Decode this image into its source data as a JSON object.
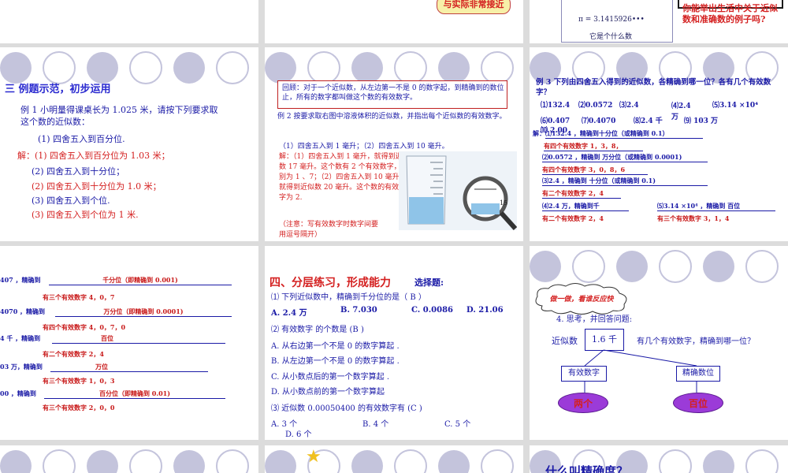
{
  "s_top2": {
    "bubble": "与实际非常接近"
  },
  "s_top3": {
    "pi": "π = 3.1415926•••",
    "pi_q": "它是个什么数",
    "q_red": "你能举出生活中关于近似数和准确数的例子吗?"
  },
  "s4": {
    "title": "三 例题示范，初步运用",
    "ex": "例 1 小明量得课桌长为 1.025 米，请按下列要求取这个数的近似数：",
    "q1": "(1) 四舍五入到百分位.",
    "a1": "解：(1) 四舍五入到百分位为 1.03 米；",
    "q2": "(2) 四舍五入到十分位；",
    "a2": "(2) 四舍五入到十分位为 1.0 米；",
    "q3": "(3) 四舍五入到个位.",
    "a3": "(3) 四舍五入到个位为 1 米."
  },
  "s5": {
    "box": "回顾：对于一个近似数，从左边第一不是 0 的数字起，到精确到的数位止，所有的数字都叫做这个数的有效数字。",
    "ex": "例 2 按要求取右图中溶液体积的近似数，并指出每个近似数的有效数字。",
    "q": "（1）四舍五入到 1 毫升；（2）四舍五入到 10 毫升。",
    "a": "解：（1）四舍五入到 1 毫升，就得到近似数 17 毫升。这个数有 2 个有效数字，分别为 1 、7；（2）四舍五入到 10 毫升，就得到近似数 20 毫升。这个数的有效数字为 2.",
    "note": "（注意：写有效数字时数字间要用逗号隔开）",
    "mag": "15"
  },
  "s6": {
    "ex": "例 3 下列由四舍五入得到的近似数，各精确到哪一位？各有几个有效数字？",
    "r1": [
      "⑴132.4",
      "⑵0.0572",
      "⑶2.4",
      "⑷2.4 万",
      "⑸3.14 ×10⁴"
    ],
    "r2": [
      "⑹0.407",
      "⑺0.4070",
      "⑻2.4 千",
      "⑼ 103 万",
      "⑽ 2.00"
    ],
    "sol_label": "解：",
    "l1": "⑴132.4 ，精确到十分位（或精确到 0.1）",
    "l1b": "有四个有效数字 1，3，8，",
    "l2": "⑵0.0572 ，精确到 万分位（或精确到 0.0001)",
    "l2b": "有四个有效数字 3，0，8，6",
    "l3": "⑶2.4 ，精确到 十分位（或精确到 0.1)",
    "l3b": "有二个有效数字 2，4",
    "l4": "⑷2.4 万，精确到千",
    "l4b": "有二个有效数字 2，4",
    "l5": "⑸3.14 ×10⁴ ，精确到 百位",
    "l5b": "有三个有效数字 3，1，4"
  },
  "s7": {
    "rows": [
      {
        "a": "407 ，精确到",
        "b": "千分位（即精确到 0.001)",
        "c": "有三个有效数字 4，0，7"
      },
      {
        "a": "4070 ，精确到",
        "b": "万分位（即精确到 0.0001)",
        "c": "有四个有效数字 4，0，7，0"
      },
      {
        "a": "4 千 ，精确到",
        "b": "百位",
        "c": "有二个有效数字 2，4"
      },
      {
        "a": "03 万，精确到",
        "b": "万位",
        "c": "有三个有效数字 1，0，3"
      },
      {
        "a": "00 ，精确到",
        "b": "百分位（即精确到 0.01)",
        "c": "有三个有效数字 2，0，0"
      }
    ]
  },
  "s8": {
    "title": "四、分层练习，形成能力",
    "title2": "选择题:",
    "q1": "⑴ 下列近似数中，精确到千分位的是（ B   ）",
    "q1o": [
      "A. 2.4 万",
      "B. 7.030",
      "C. 0.0086",
      "D. 21.06"
    ],
    "q2": "⑵ 有效数字 的个数是 (B   )",
    "q2o": [
      "A. 从右边第一个不是 0 的数字算起 .",
      "B. 从左边第一个不是 0 的数字算起 .",
      "C. 从小数点后的第一个数字算起 .",
      "D. 从小数点前的第一个数字算起"
    ],
    "q3": "⑶ 近似数 0.00050400 的有效数字有 (C    )",
    "q3o": [
      "A. 3 个",
      "B. 4 个",
      "C. 5 个",
      "D. 6 个"
    ]
  },
  "s9": {
    "cloud": "做一做，看谁反应快",
    "q": "4. 思考，并回答问题:",
    "left": "近似数",
    "value": "1.6 千",
    "right": "有几个有效数字，精确到哪一位？",
    "box1": "有效数字",
    "box2": "精确数位",
    "ell1": "两个",
    "ell2": "百位"
  },
  "s12": {
    "title": "什么叫精确度？"
  }
}
